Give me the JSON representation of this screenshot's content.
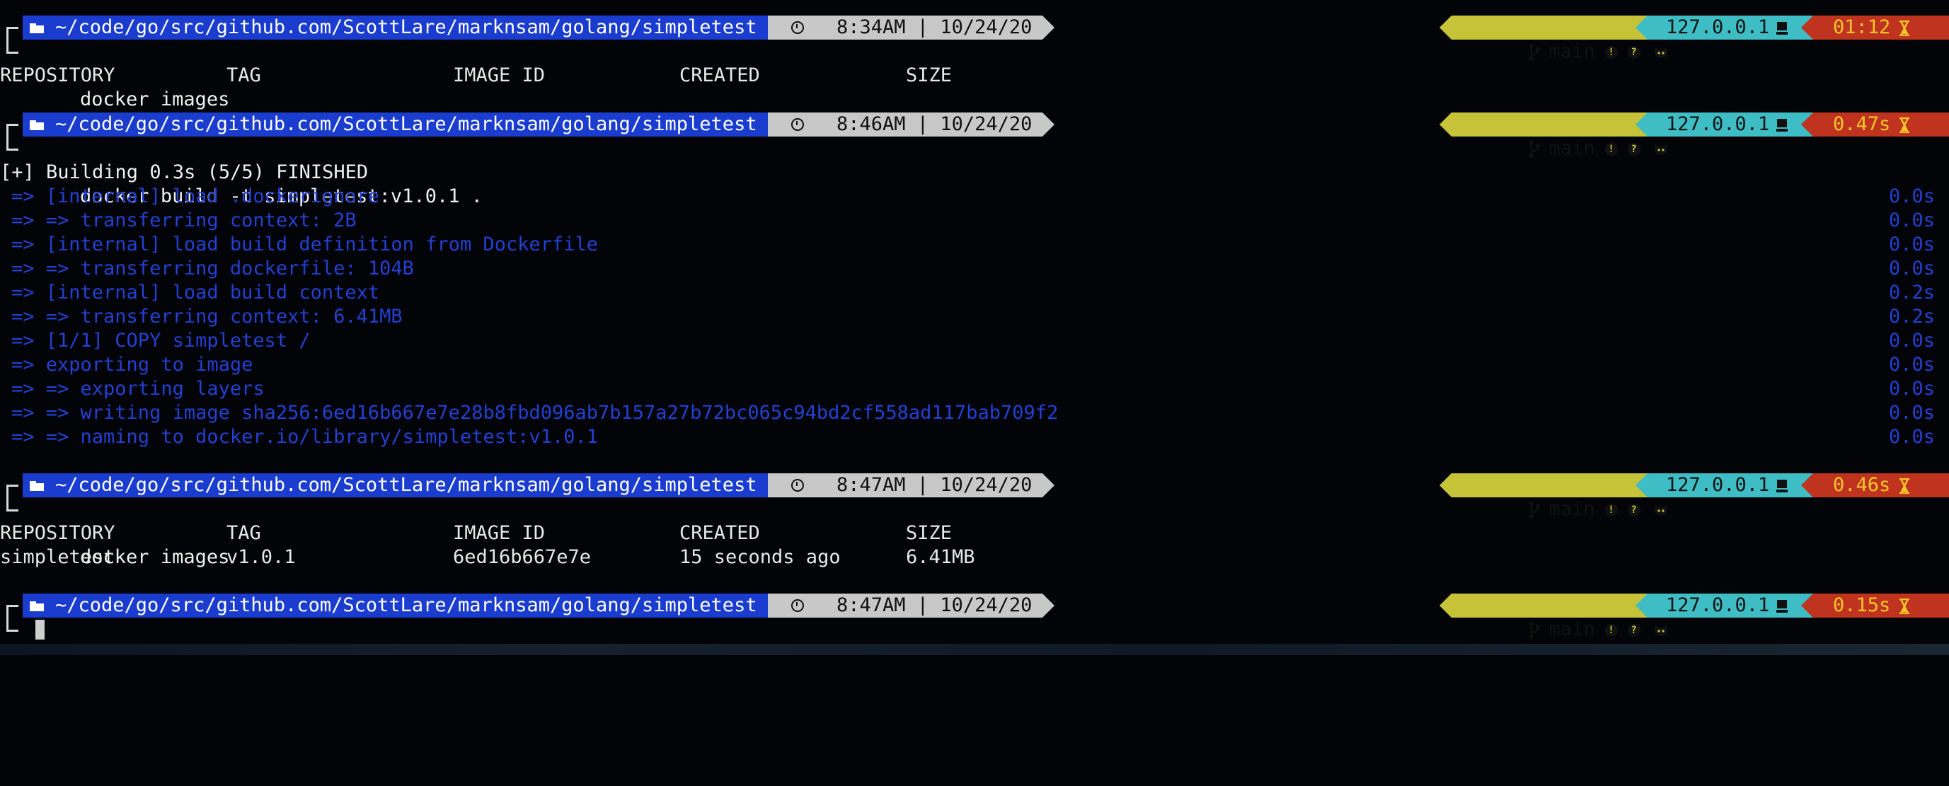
{
  "colors": {
    "background": "#020407",
    "path_segment": "#1a3ccf",
    "time_segment": "#c8c8c8",
    "git_segment": "#c7c339",
    "host_segment": "#3fbdc4",
    "duration_segment": "#c0331f",
    "duration_text": "#f2c72c",
    "build_log_text": "#2440d2"
  },
  "icons": [
    "folder-icon",
    "clock-icon",
    "git-branch-icon",
    "alert-icon",
    "help-icon",
    "github-octocat-icon",
    "computer-icon",
    "hourglass-icon"
  ],
  "prompts": [
    {
      "path": "~/code/go/src/github.com/ScottLare/marknsam/golang/simpletest",
      "time": "8:34AM",
      "date": "10/24/20",
      "branch": "main",
      "host": "127.0.0.1",
      "duration": "01:12",
      "command": "docker images"
    },
    {
      "path": "~/code/go/src/github.com/ScottLare/marknsam/golang/simpletest",
      "time": "8:46AM",
      "date": "10/24/20",
      "branch": "main",
      "host": "127.0.0.1",
      "duration": "0.47s",
      "command": "docker build -t simpletest:v1.0.1 ."
    },
    {
      "path": "~/code/go/src/github.com/ScottLare/marknsam/golang/simpletest",
      "time": "8:47AM",
      "date": "10/24/20",
      "branch": "main",
      "host": "127.0.0.1",
      "duration": "0.46s",
      "command": "docker images"
    },
    {
      "path": "~/code/go/src/github.com/ScottLare/marknsam/golang/simpletest",
      "time": "8:47AM",
      "date": "10/24/20",
      "branch": "main",
      "host": "127.0.0.1",
      "duration": "0.15s",
      "command": ""
    }
  ],
  "images_table": {
    "headers": [
      "REPOSITORY",
      "TAG",
      "IMAGE ID",
      "CREATED",
      "SIZE"
    ],
    "rows": [
      [
        "simpletest",
        "v1.0.1",
        "6ed16b667e7e",
        "15 seconds ago",
        "6.41MB"
      ]
    ]
  },
  "build_output": {
    "summary": "[+] Building 0.3s (5/5) FINISHED",
    "steps": [
      {
        "text": "=> [internal] load .dockerignore",
        "time": "0.0s"
      },
      {
        "text": "=> => transferring context: 2B",
        "time": "0.0s"
      },
      {
        "text": "=> [internal] load build definition from Dockerfile",
        "time": "0.0s"
      },
      {
        "text": "=> => transferring dockerfile: 104B",
        "time": "0.0s"
      },
      {
        "text": "=> [internal] load build context",
        "time": "0.2s"
      },
      {
        "text": "=> => transferring context: 6.41MB",
        "time": "0.2s"
      },
      {
        "text": "=> [1/1] COPY simpletest /",
        "time": "0.0s"
      },
      {
        "text": "=> exporting to image",
        "time": "0.0s"
      },
      {
        "text": "=> => exporting layers",
        "time": "0.0s"
      },
      {
        "text": "=> => writing image sha256:6ed16b667e7e28b8fbd096ab7b157a27b72bc065c94bd2cf558ad117bab709f2",
        "time": "0.0s"
      },
      {
        "text": "=> => naming to docker.io/library/simpletest:v1.0.1",
        "time": "0.0s"
      }
    ]
  }
}
